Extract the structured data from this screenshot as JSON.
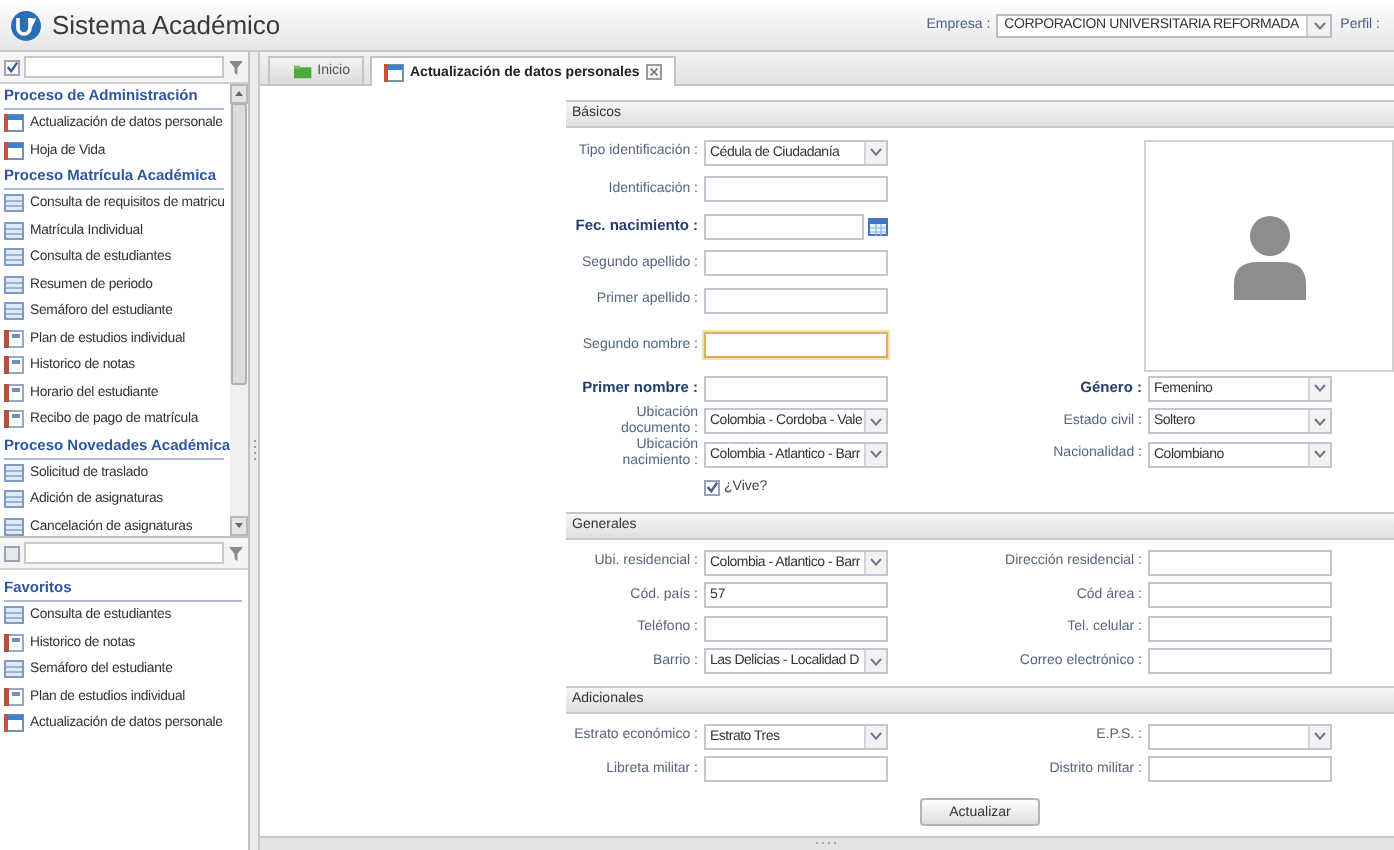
{
  "header": {
    "title": "Sistema Académico",
    "company_label": "Empresa :",
    "company": "CORPORACION UNIVERSITARIA REFORMADA",
    "profile_label": "Perfil :"
  },
  "sidebar": {
    "filter": {
      "checked": true
    },
    "groups": [
      {
        "title": "Proceso de Administración",
        "items": [
          {
            "label": "Actualización de datos personale",
            "kind": "calendar"
          },
          {
            "label": "Hoja de Vida",
            "kind": "calendar"
          }
        ]
      },
      {
        "title": "Proceso Matrícula Académica",
        "items": [
          {
            "label": "Consulta de requisitos de matricu",
            "kind": "table"
          },
          {
            "label": "Matrícula Individual",
            "kind": "table"
          },
          {
            "label": "Consulta de estudiantes",
            "kind": "table"
          },
          {
            "label": "Resumen de periodo",
            "kind": "table"
          },
          {
            "label": "Semáforo del estudiante",
            "kind": "table"
          },
          {
            "label": "Plan de estudios individual",
            "kind": "document"
          },
          {
            "label": "Historico de notas",
            "kind": "document"
          },
          {
            "label": "Horario del estudiante",
            "kind": "document"
          },
          {
            "label": "Recibo de pago de matrícula",
            "kind": "document"
          }
        ]
      },
      {
        "title": "Proceso Novedades Académica",
        "items": [
          {
            "label": "Solicitud de traslado",
            "kind": "table"
          },
          {
            "label": "Adición de asignaturas",
            "kind": "table"
          },
          {
            "label": "Cancelación de asignaturas",
            "kind": "table"
          }
        ]
      }
    ]
  },
  "favorites": {
    "filter": {
      "checked": false
    },
    "title": "Favoritos",
    "items": [
      {
        "label": "Consulta de estudiantes",
        "kind": "table"
      },
      {
        "label": "Historico de notas",
        "kind": "document"
      },
      {
        "label": "Semáforo del estudiante",
        "kind": "table"
      },
      {
        "label": "Plan de estudios individual",
        "kind": "document"
      },
      {
        "label": "Actualización de datos personale",
        "kind": "calendar"
      }
    ]
  },
  "tabs": [
    {
      "label": "Inicio",
      "kind": "folder",
      "selected": false,
      "closable": false
    },
    {
      "label": "Actualización de datos personales",
      "kind": "calendar",
      "selected": true,
      "closable": true
    }
  ],
  "form": {
    "sections": [
      {
        "title": "Básicos",
        "avatar": true,
        "rows": [
          {
            "left": {
              "label": "Tipo identificación :",
              "kind": "select",
              "value": "Cédula de Ciudadanía",
              "required": false,
              "focused": false
            }
          },
          {
            "left": {
              "label": "Identificación :",
              "kind": "text",
              "required": false,
              "focused": false
            }
          },
          {
            "left": {
              "label": "Fec. nacimiento :",
              "kind": "date",
              "required": true,
              "focused": false
            }
          },
          {
            "left": {
              "label": "Segundo apellido :",
              "kind": "text",
              "required": false,
              "focused": false
            }
          },
          {
            "left": {
              "label": "Primer apellido :",
              "kind": "text",
              "required": false,
              "focused": false
            }
          },
          {
            "left": {
              "label": "Segundo nombre :",
              "kind": "text",
              "required": false,
              "focused": true
            }
          },
          {
            "left": {
              "label": "Primer nombre :",
              "kind": "text",
              "required": true,
              "focused": false
            },
            "right": {
              "label": "Género :",
              "kind": "select",
              "value": "Femenino",
              "required": true,
              "focused": false
            }
          },
          {
            "left": {
              "label": "Ubicación documento :",
              "kind": "select",
              "value": "Colombia - Cordoba - Vale",
              "required": false,
              "focused": false
            },
            "right": {
              "label": "Estado civil :",
              "kind": "select",
              "value": "Soltero",
              "required": false,
              "focused": false
            }
          },
          {
            "left": {
              "label": "Ubicación nacimiento :",
              "kind": "select",
              "value": "Colombia - Atlantico - Barr",
              "required": false,
              "focused": false
            },
            "right": {
              "label": "Nacionalidad :",
              "kind": "select",
              "value": "Colombiano",
              "required": false,
              "focused": false
            }
          },
          {
            "left": {
              "label": "¿Vive?",
              "kind": "checkbox",
              "checked": true
            }
          }
        ]
      },
      {
        "title": "Generales",
        "avatar": false,
        "rows": [
          {
            "left": {
              "label": "Ubi. residencial :",
              "kind": "select",
              "value": "Colombia - Atlantico - Barr",
              "required": false,
              "focused": false
            },
            "right": {
              "label": "Dirección residencial :",
              "kind": "text",
              "required": false,
              "focused": false
            }
          },
          {
            "left": {
              "label": "Cód. país :",
              "kind": "text",
              "value": "57",
              "required": false,
              "focused": false
            },
            "right": {
              "label": "Cód área :",
              "kind": "text",
              "required": false,
              "focused": false
            }
          },
          {
            "left": {
              "label": "Teléfono :",
              "kind": "text",
              "required": false,
              "focused": false
            },
            "right": {
              "label": "Tel. celular :",
              "kind": "text",
              "required": false,
              "focused": false
            }
          },
          {
            "left": {
              "label": "Barrio :",
              "kind": "select",
              "value": "Las Delicias - Localidad D",
              "required": false,
              "focused": false
            },
            "right": {
              "label": "Correo electrónico :",
              "kind": "text",
              "required": false,
              "focused": false
            }
          }
        ]
      },
      {
        "title": "Adicionales",
        "avatar": false,
        "rows": [
          {
            "left": {
              "label": "Estrato económico :",
              "kind": "select",
              "value": "Estrato Tres",
              "required": false,
              "focused": false
            },
            "right": {
              "label": "E.P.S. :",
              "kind": "select",
              "required": false,
              "focused": false
            }
          },
          {
            "left": {
              "label": "Libreta militar :",
              "kind": "text",
              "required": false,
              "focused": false
            },
            "right": {
              "label": "Distrito militar :",
              "kind": "text",
              "required": false,
              "focused": false
            }
          }
        ]
      }
    ],
    "actions": [
      {
        "label": "Actualizar"
      }
    ]
  }
}
